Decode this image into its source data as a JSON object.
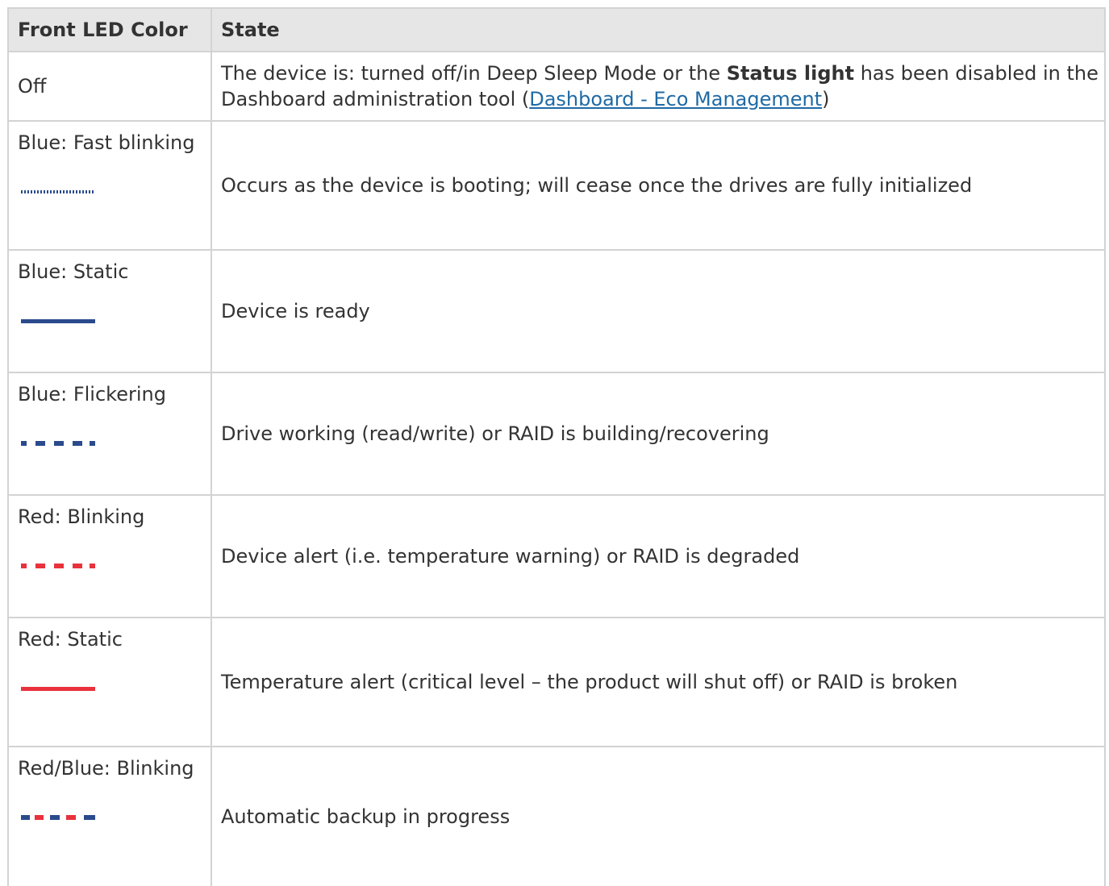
{
  "table": {
    "headers": {
      "color": "Front LED Color",
      "state": "State"
    },
    "off_row": {
      "color": "Off",
      "state_prefix": "The device is: turned off/in Deep Sleep Mode or the ",
      "state_bold": "Status light",
      "state_middle": " has been disabled in the Dashboard administration tool (",
      "state_link": "Dashboard - Eco Management",
      "state_suffix": ")"
    },
    "rows": [
      {
        "color": "Blue: Fast blinking",
        "state": "Occurs as the device is booting; will cease once the drives are fully initialized",
        "led_icon": "led-blue-fast-blink"
      },
      {
        "color": "Blue: Static",
        "state": "Device is ready",
        "led_icon": "led-blue-static"
      },
      {
        "color": "Blue: Flickering",
        "state": "Drive working (read/write) or RAID is building/recovering",
        "led_icon": "led-blue-flicker"
      },
      {
        "color": "Red: Blinking",
        "state": "Device alert (i.e. temperature warning) or RAID is degraded",
        "led_icon": "led-red-blink"
      },
      {
        "color": "Red: Static",
        "state": "Temperature alert (critical level – the product will shut off) or RAID is broken",
        "led_icon": "led-red-static"
      },
      {
        "color": "Red/Blue: Blinking",
        "state": "Automatic backup in progress",
        "led_icon": "led-redblue-blink"
      }
    ]
  },
  "colors": {
    "led_blue": "#2a4a8c",
    "led_red": "#e8323c",
    "link": "#1f6aa5",
    "header_bg": "#e6e6e6",
    "border": "#d3d3d3"
  }
}
